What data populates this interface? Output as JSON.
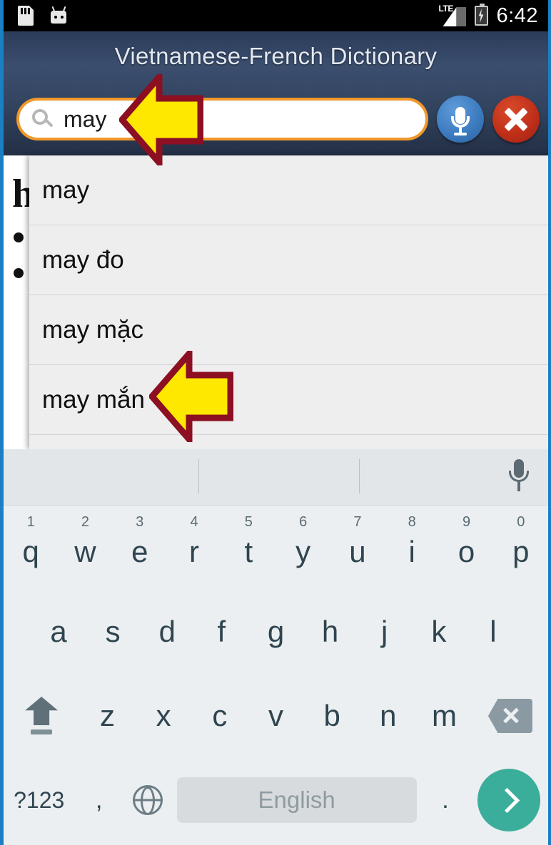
{
  "status_bar": {
    "icons_left": [
      "sd-card-icon",
      "android-head-icon"
    ],
    "network": "LTE",
    "battery": "charging",
    "time": "6:42"
  },
  "app_header": {
    "title": "Vietnamese-French Dictionary",
    "background_color": "#32445f"
  },
  "search": {
    "value": "may",
    "placeholder": "",
    "icon": "search-icon",
    "border_color": "#f0982a",
    "mic_button": {
      "icon": "microphone-icon",
      "color": "#3d7cc0"
    },
    "clear_button": {
      "icon": "close-x-icon",
      "color": "#c0301a"
    }
  },
  "suggestions": {
    "items": [
      {
        "label": "may"
      },
      {
        "label": "may đo"
      },
      {
        "label": "may mặc"
      },
      {
        "label": "may mắn"
      },
      {
        "label": ""
      }
    ]
  },
  "content": {
    "headword": "h",
    "bullets": [
      "",
      ""
    ]
  },
  "keyboard": {
    "suggestion_strip": {
      "mic_icon": "microphone-icon",
      "suggestions": [
        "",
        "",
        ""
      ]
    },
    "row1": [
      {
        "letter": "q",
        "num": "1"
      },
      {
        "letter": "w",
        "num": "2"
      },
      {
        "letter": "e",
        "num": "3"
      },
      {
        "letter": "r",
        "num": "4"
      },
      {
        "letter": "t",
        "num": "5"
      },
      {
        "letter": "y",
        "num": "6"
      },
      {
        "letter": "u",
        "num": "7"
      },
      {
        "letter": "i",
        "num": "8"
      },
      {
        "letter": "o",
        "num": "9"
      },
      {
        "letter": "p",
        "num": "0"
      }
    ],
    "row2": [
      {
        "letter": "a"
      },
      {
        "letter": "s"
      },
      {
        "letter": "d"
      },
      {
        "letter": "f"
      },
      {
        "letter": "g"
      },
      {
        "letter": "h"
      },
      {
        "letter": "j"
      },
      {
        "letter": "k"
      },
      {
        "letter": "l"
      }
    ],
    "row3": {
      "shift": "shift-icon",
      "letters": [
        {
          "letter": "z"
        },
        {
          "letter": "x"
        },
        {
          "letter": "c"
        },
        {
          "letter": "v"
        },
        {
          "letter": "b"
        },
        {
          "letter": "n"
        },
        {
          "letter": "m"
        }
      ],
      "backspace": "backspace-icon"
    },
    "row4": {
      "symbols": "?123",
      "comma": ",",
      "globe": "globe-icon",
      "space_label": "English",
      "period": ".",
      "enter": "enter-chevron-icon",
      "enter_color": "#3aae9b"
    }
  },
  "annotations": {
    "arrow_fill": "#ffe800",
    "arrow_stroke": "#8c0f22",
    "arrow_search_target": "search-input",
    "arrow_suggestion_target": "suggestion-may-man"
  }
}
